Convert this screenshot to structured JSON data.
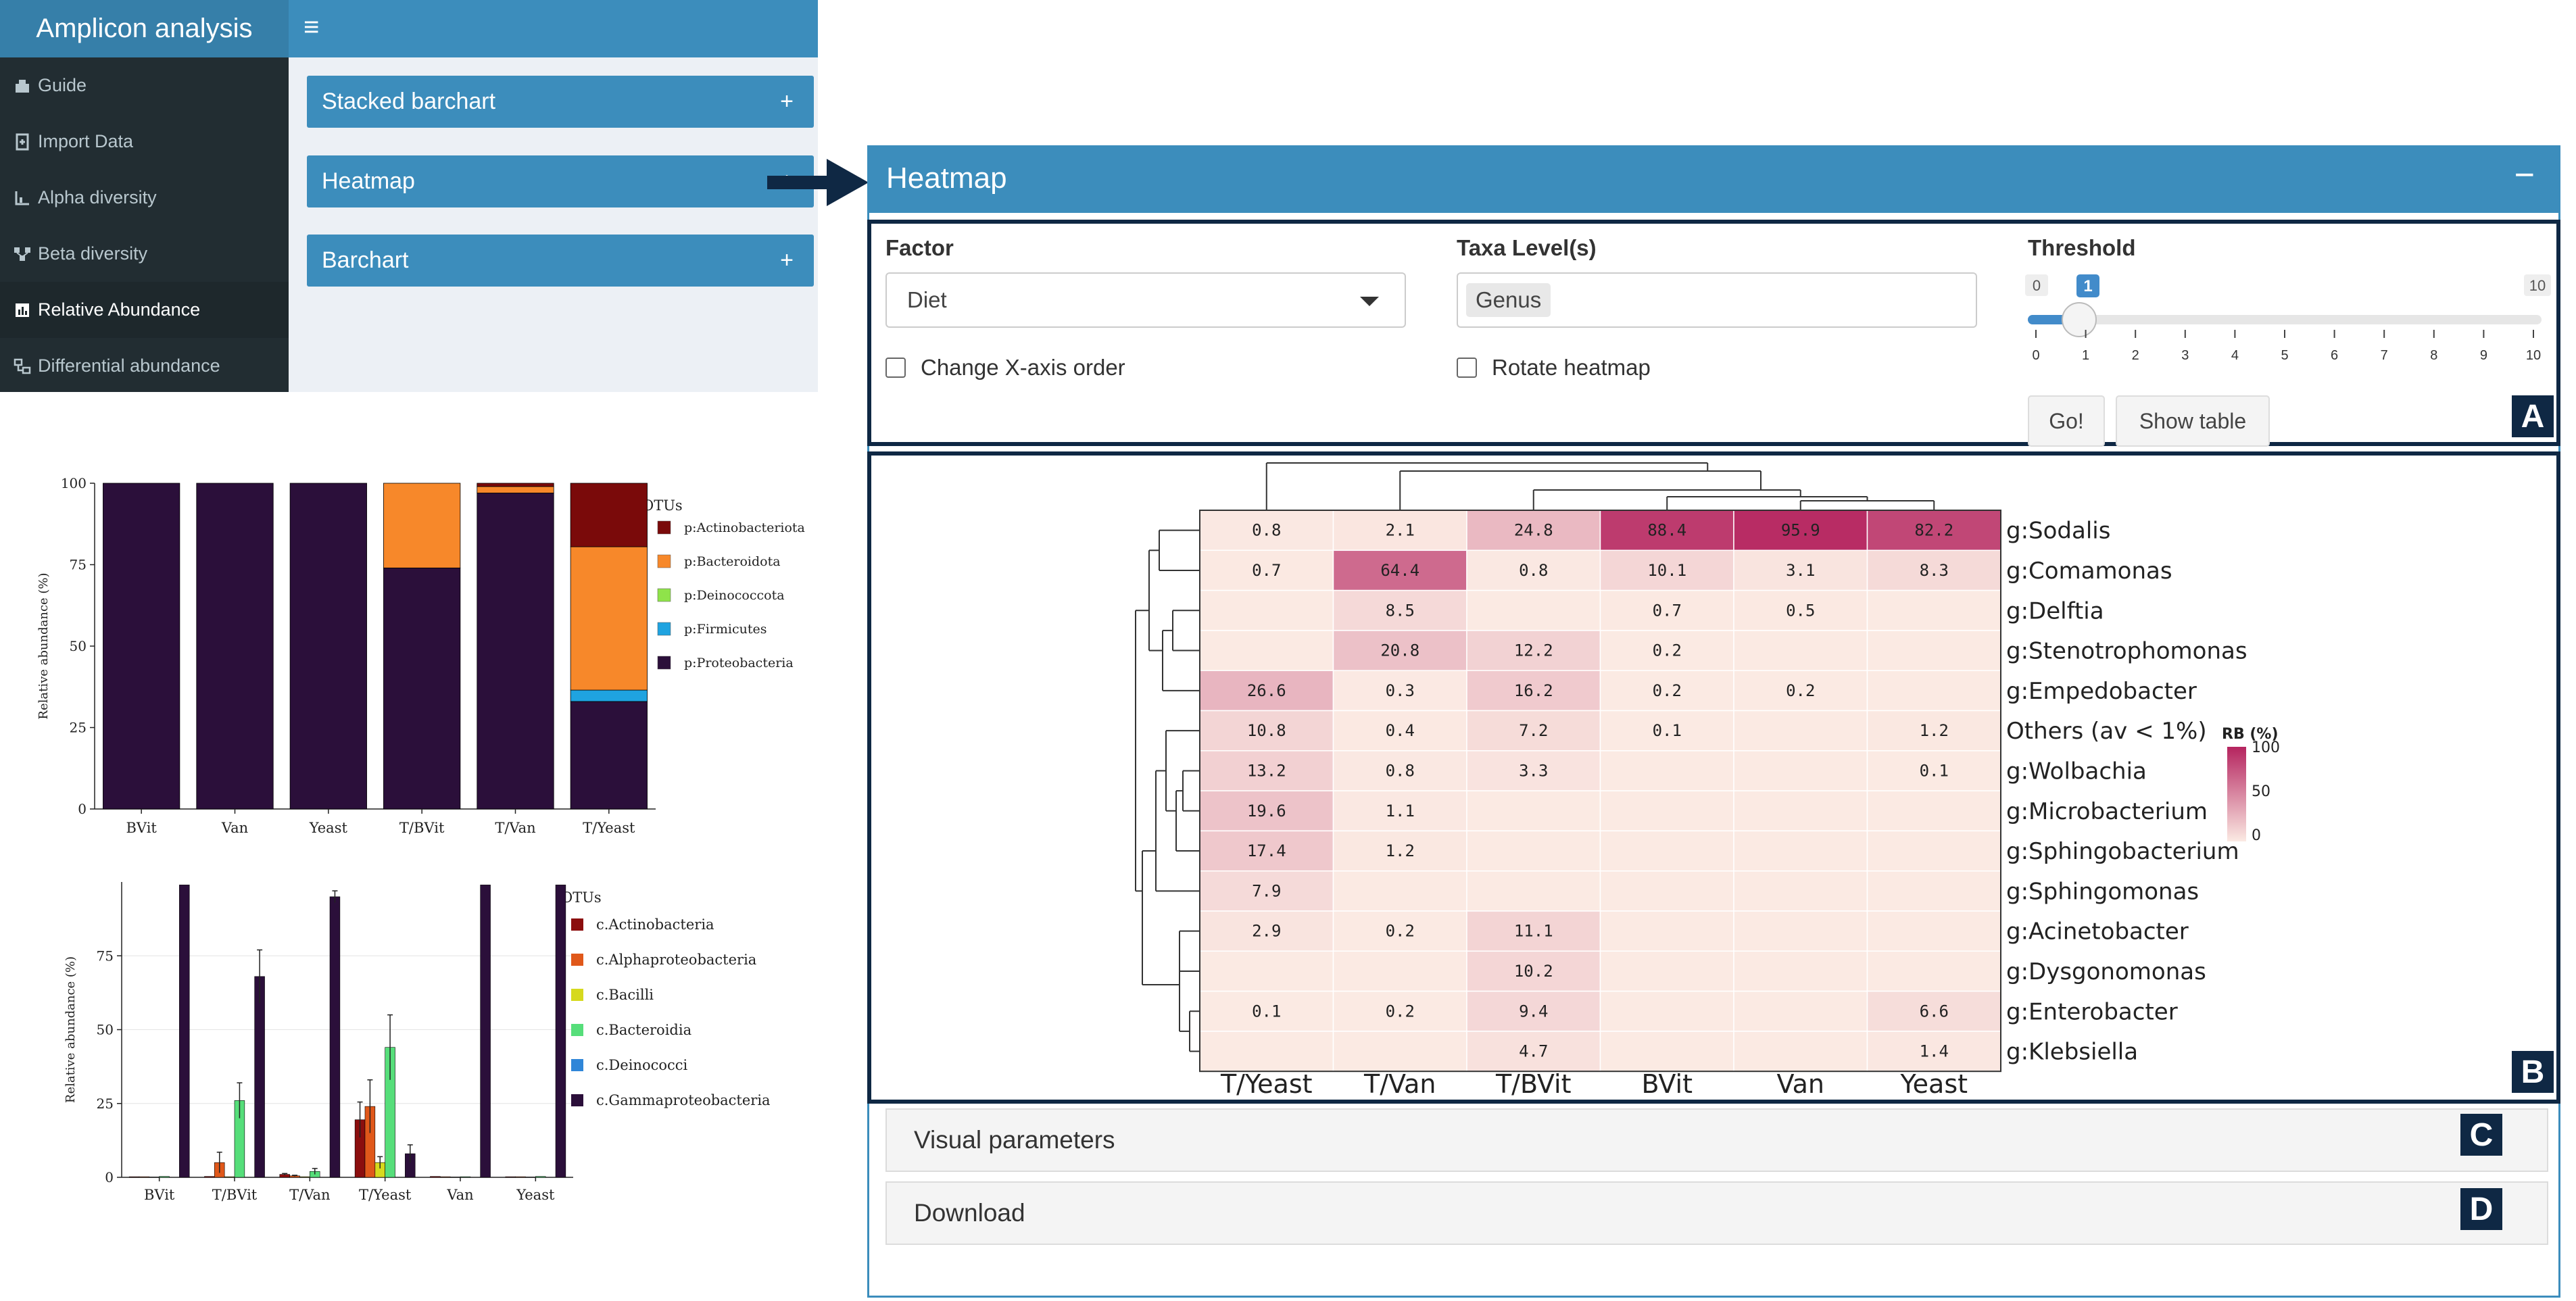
{
  "app": {
    "brand": "Amplicon analysis",
    "menu_icon": "≡",
    "sidebar": [
      {
        "label": "Guide",
        "icon": "guide-icon",
        "active": false
      },
      {
        "label": "Import Data",
        "icon": "import-icon",
        "active": false
      },
      {
        "label": "Alpha diversity",
        "icon": "chart-icon",
        "active": false
      },
      {
        "label": "Beta diversity",
        "icon": "network-icon",
        "active": false
      },
      {
        "label": "Relative Abundance",
        "icon": "bar-chart-icon",
        "active": true
      },
      {
        "label": "Differential abundance",
        "icon": "diff-icon",
        "active": false
      }
    ],
    "boxes": [
      {
        "label": "Stacked barchart",
        "toggle": "+"
      },
      {
        "label": "Heatmap",
        "toggle": "+"
      },
      {
        "label": "Barchart",
        "toggle": "+"
      }
    ]
  },
  "panel": {
    "title": "Heatmap",
    "collapse_icon": "−",
    "factor": {
      "label": "Factor",
      "value": "Diet"
    },
    "taxa": {
      "label": "Taxa Level(s)",
      "value": "Genus"
    },
    "threshold": {
      "label": "Threshold",
      "min": "0",
      "max": "10",
      "value": "1",
      "ticks": [
        "0",
        "1",
        "2",
        "3",
        "4",
        "5",
        "6",
        "7",
        "8",
        "9",
        "10"
      ]
    },
    "change_x_order": "Change X-axis order",
    "rotate": "Rotate heatmap",
    "go_button": "Go!",
    "show_table_button": "Show table",
    "visual_parameters": "Visual parameters",
    "download": "Download",
    "letters": [
      "A",
      "B",
      "C",
      "D"
    ]
  },
  "heatmap": {
    "columns": [
      "T/Yeast",
      "T/Van",
      "T/BVit",
      "BVit",
      "Van",
      "Yeast"
    ],
    "rows": [
      {
        "label": "g:Sodalis",
        "values": [
          0.8,
          2.1,
          24.8,
          88.4,
          95.9,
          82.2
        ]
      },
      {
        "label": "g:Comamonas",
        "values": [
          0.7,
          64.4,
          0.8,
          10.1,
          3.1,
          8.3
        ]
      },
      {
        "label": "g:Delftia",
        "values": [
          null,
          8.5,
          null,
          0.7,
          0.5,
          null
        ]
      },
      {
        "label": "g:Stenotrophomonas",
        "values": [
          null,
          20.8,
          12.2,
          0.2,
          null,
          null
        ]
      },
      {
        "label": "g:Empedobacter",
        "values": [
          26.6,
          0.3,
          16.2,
          0.2,
          0.2,
          null
        ]
      },
      {
        "label": "Others (av < 1%)",
        "values": [
          10.8,
          0.4,
          7.2,
          0.1,
          null,
          1.2
        ]
      },
      {
        "label": "g:Wolbachia",
        "values": [
          13.2,
          0.8,
          3.3,
          null,
          null,
          0.1
        ]
      },
      {
        "label": "g:Microbacterium",
        "values": [
          19.6,
          1.1,
          null,
          null,
          null,
          null
        ]
      },
      {
        "label": "g:Sphingobacterium",
        "values": [
          17.4,
          1.2,
          null,
          null,
          null,
          null
        ]
      },
      {
        "label": "g:Sphingomonas",
        "values": [
          7.9,
          null,
          null,
          null,
          null,
          null
        ]
      },
      {
        "label": "g:Acinetobacter",
        "values": [
          2.9,
          0.2,
          11.1,
          null,
          null,
          null
        ]
      },
      {
        "label": "g:Dysgonomonas",
        "values": [
          null,
          null,
          10.2,
          null,
          null,
          null
        ]
      },
      {
        "label": "g:Enterobacter",
        "values": [
          0.1,
          0.2,
          9.4,
          null,
          null,
          6.6
        ]
      },
      {
        "label": "g:Klebsiella",
        "values": [
          null,
          null,
          4.7,
          null,
          null,
          1.4
        ]
      }
    ],
    "legend": {
      "title": "RB (%)",
      "ticks": [
        "100",
        "50",
        "0"
      ]
    },
    "color_low": "#fbeae3",
    "color_high": "#b5245f"
  },
  "chart_data": [
    {
      "type": "bar",
      "stacked": true,
      "categories": [
        "BVit",
        "Van",
        "Yeast",
        "T/BVit",
        "T/Van",
        "T/Yeast"
      ],
      "ylabel": "Relative abundance (%)",
      "ylim": [
        0,
        100
      ],
      "yticks": [
        "0",
        "25",
        "50",
        "75",
        "100"
      ],
      "legend_title": "OTUs",
      "series": [
        {
          "name": "p:Proteobacteria",
          "color": "#2b0f3a",
          "values": [
            100,
            100,
            100,
            74,
            97,
            33
          ]
        },
        {
          "name": "p:Firmicutes",
          "color": "#1fa3e0",
          "values": [
            0,
            0,
            0,
            0,
            0,
            3.5
          ]
        },
        {
          "name": "p:Deinococcota",
          "color": "#8fe34a",
          "values": [
            0,
            0,
            0,
            0,
            0,
            0
          ]
        },
        {
          "name": "p:Bacteroidota",
          "color": "#f7882a",
          "values": [
            0,
            0,
            0,
            26,
            2,
            44
          ]
        },
        {
          "name": "p:Actinobacteriota",
          "color": "#7a0a0a",
          "values": [
            0,
            0,
            0,
            0,
            1,
            19.5
          ]
        }
      ],
      "legend_order": [
        "p:Actinobacteriota",
        "p:Bacteroidota",
        "p:Deinococcota",
        "p:Firmicutes",
        "p:Proteobacteria"
      ]
    },
    {
      "type": "bar",
      "grouped": true,
      "categories": [
        "BVit",
        "T/BVit",
        "T/Van",
        "T/Yeast",
        "Van",
        "Yeast"
      ],
      "ylabel": "Relative abundance (%)",
      "ylim": [
        0,
        100
      ],
      "yticks": [
        "0",
        "25",
        "50",
        "75"
      ],
      "legend_title": "OTUs",
      "series": [
        {
          "name": "c.Actinobacteria",
          "color": "#8b0e0e",
          "values": [
            0.2,
            0.3,
            1,
            19.5,
            0.3,
            0.2
          ],
          "err": [
            0,
            0,
            0.3,
            6,
            0,
            0
          ]
        },
        {
          "name": "c.Alphaproteobacteria",
          "color": "#e0581a",
          "values": [
            0.2,
            5,
            0.5,
            24,
            0.2,
            0.2
          ],
          "err": [
            0,
            3.5,
            0.2,
            9,
            0,
            0
          ]
        },
        {
          "name": "c.Bacilli",
          "color": "#d6d91e",
          "values": [
            0.1,
            0.2,
            0.2,
            5,
            0.1,
            0.1
          ],
          "err": [
            0,
            0,
            0,
            2,
            0,
            0
          ]
        },
        {
          "name": "c.Bacteroidia",
          "color": "#56de7a",
          "values": [
            0.3,
            26,
            2,
            44,
            0.2,
            0.3
          ],
          "err": [
            0,
            6,
            1,
            11,
            0,
            0
          ]
        },
        {
          "name": "c.Deinococci",
          "color": "#2f86d8",
          "values": [
            0,
            0,
            0,
            0,
            0,
            0
          ],
          "err": [
            0,
            0,
            0,
            0,
            0,
            0
          ]
        },
        {
          "name": "c.Gammaproteobacteria",
          "color": "#2b0f3a",
          "values": [
            99,
            68,
            95,
            8,
            99,
            99
          ],
          "err": [
            0,
            9,
            2,
            3,
            0,
            0
          ]
        }
      ]
    }
  ]
}
